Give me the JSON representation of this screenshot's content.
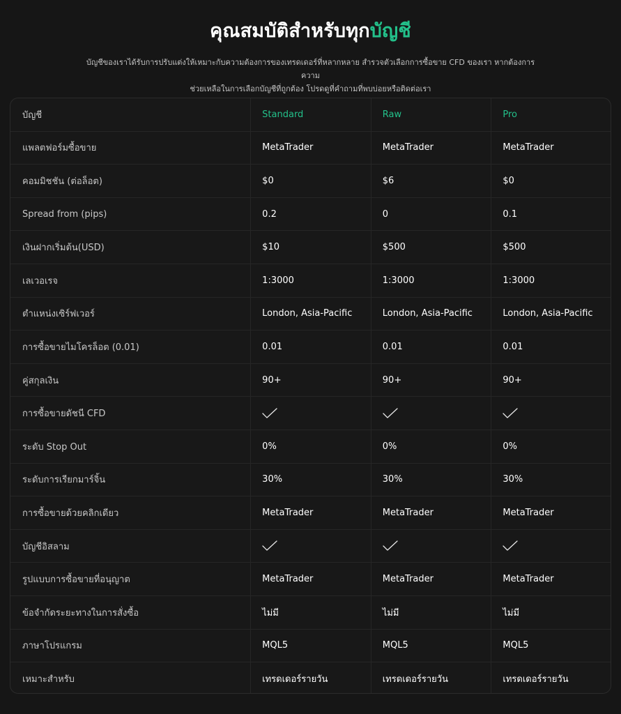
{
  "header": {
    "title_main": "คุณสมบัติสำหรับทุก",
    "title_highlight": "บัญชี",
    "subtitle_line1": "บัญชีของเราได้รับการปรับแต่งให้เหมาะกับความต้องการของเทรดเดอร์ที่หลากหลาย สำรวจตัวเลือกการซื้อขาย CFD ของเรา หากต้องการความ",
    "subtitle_line2": "ช่วยเหลือในการเลือกบัญชีที่ถูกต้อง โปรดดูที่คำถามที่พบบ่อยหรือติดต่อเรา"
  },
  "colors": {
    "accent": "#23c08a",
    "background": "#161616",
    "text": "#ffffff",
    "muted_text": "#c8c8c8",
    "border": "#262626"
  },
  "table": {
    "header": [
      "บัญชี",
      "Standard",
      "Raw",
      "Pro"
    ],
    "rows": [
      {
        "label": "แพลตฟอร์มซื้อขาย",
        "values": [
          "MetaTrader",
          "MetaTrader",
          "MetaTrader"
        ]
      },
      {
        "label": "คอมมิชชัน (ต่อล็อต)",
        "values": [
          "$0",
          "$6",
          "$0"
        ]
      },
      {
        "label": "Spread from (pips)",
        "values": [
          "0.2",
          "0",
          "0.1"
        ]
      },
      {
        "label": "เงินฝากเริ่มต้น(USD)",
        "values": [
          "$10",
          "$500",
          "$500"
        ]
      },
      {
        "label": "เลเวอเรจ",
        "values": [
          "1:3000",
          "1:3000",
          "1:3000"
        ]
      },
      {
        "label": "ตำแหน่งเซิร์ฟเวอร์",
        "values": [
          "London, Asia-Pacific",
          "London, Asia-Pacific",
          "London, Asia-Pacific"
        ]
      },
      {
        "label": "การซื้อขายไมโครล็อต (0.01)",
        "values": [
          "0.01",
          "0.01",
          "0.01"
        ]
      },
      {
        "label": "คู่สกุลเงิน",
        "values": [
          "90+",
          "90+",
          "90+"
        ]
      },
      {
        "label": "การซื้อขายดัชนี CFD",
        "values": [
          "check-icon",
          "check-icon",
          "check-icon"
        ]
      },
      {
        "label": "ระดับ Stop Out",
        "values": [
          "0%",
          "0%",
          "0%"
        ]
      },
      {
        "label": "ระดับการเรียกมาร์จิ้น",
        "values": [
          "30%",
          "30%",
          "30%"
        ]
      },
      {
        "label": "การซื้อขายด้วยคลิกเดียว",
        "values": [
          "MetaTrader",
          "MetaTrader",
          "MetaTrader"
        ]
      },
      {
        "label": "บัญชีอิสลาม",
        "values": [
          "check-icon",
          "check-icon",
          "check-icon"
        ]
      },
      {
        "label": "รูปแบบการซื้อขายที่อนุญาต",
        "values": [
          "MetaTrader",
          "MetaTrader",
          "MetaTrader"
        ]
      },
      {
        "label": "ข้อจำกัดระยะทางในการสั่งซื้อ",
        "values": [
          "ไม่มี",
          "ไม่มี",
          "ไม่มี"
        ]
      },
      {
        "label": "ภาษาโปรแกรม",
        "values": [
          "MQL5",
          "MQL5",
          "MQL5"
        ]
      },
      {
        "label": "เหมาะสำหรับ",
        "values": [
          "เทรดเดอร์รายวัน",
          "เทรดเดอร์รายวัน",
          "เทรดเดอร์รายวัน"
        ]
      }
    ]
  }
}
